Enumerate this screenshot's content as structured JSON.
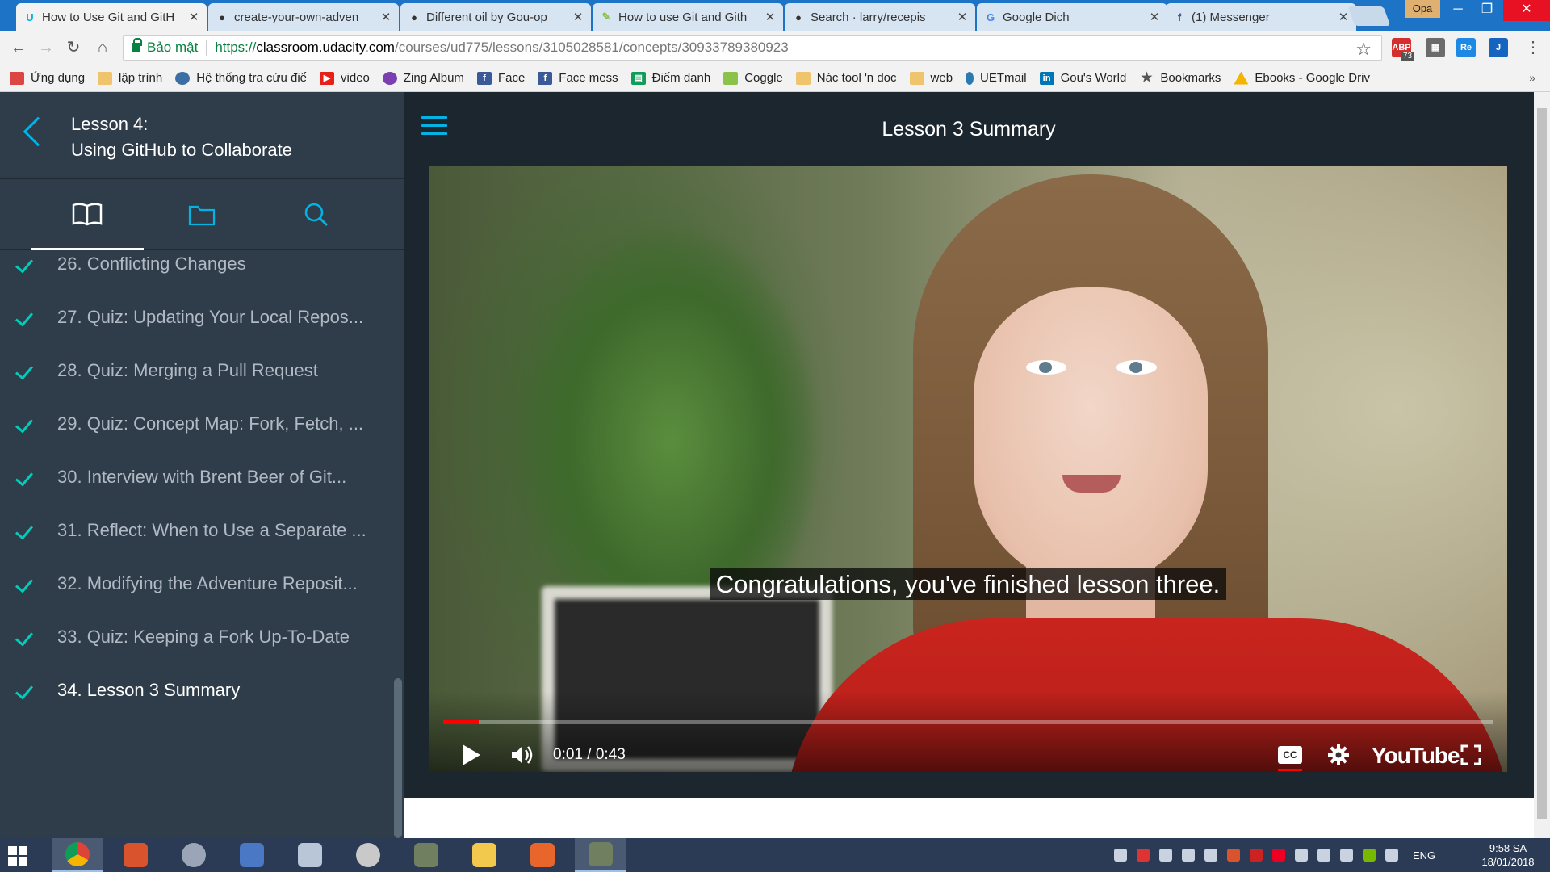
{
  "browser": {
    "tabs": [
      {
        "title": "How to Use Git and GitH",
        "favicon": "udacity-icon",
        "active": true
      },
      {
        "title": "create-your-own-adven",
        "favicon": "github-icon",
        "active": false
      },
      {
        "title": "Different oil by Gou-op",
        "favicon": "github-icon",
        "active": false
      },
      {
        "title": "How to use Git and Gith",
        "favicon": "coggle-icon",
        "active": false
      },
      {
        "title": "Search · larry/recepis",
        "favicon": "github-icon",
        "active": false
      },
      {
        "title": "Google Dich",
        "favicon": "google-translate-icon",
        "active": false
      },
      {
        "title": "(1) Messenger",
        "favicon": "facebook-icon",
        "active": false
      }
    ],
    "profile_label": "Opa",
    "security_label": "Bảo mật",
    "url": {
      "scheme": "https://",
      "host": "classroom.udacity.com",
      "path": "/courses/ud775/lessons/3105028581/concepts/30933789380923"
    },
    "extension_badge": "73",
    "bookmarks": [
      {
        "label": "Ứng dụng",
        "icon": "apps-grid-icon",
        "color": "#d44"
      },
      {
        "label": "lập trình",
        "icon": "folder-icon",
        "color": "#f0c36d"
      },
      {
        "label": "Hệ thống tra cứu điể",
        "icon": "globe-icon",
        "color": "#3a6ea5"
      },
      {
        "label": "video",
        "icon": "youtube-icon",
        "color": "#e62117"
      },
      {
        "label": "Zing Album",
        "icon": "zing-icon",
        "color": "#7b3fb0"
      },
      {
        "label": "Face",
        "icon": "facebook-icon",
        "color": "#3b5998"
      },
      {
        "label": "Face mess",
        "icon": "facebook-icon",
        "color": "#3b5998"
      },
      {
        "label": "Điểm danh",
        "icon": "sheets-icon",
        "color": "#0f9d58"
      },
      {
        "label": "Coggle",
        "icon": "coggle-icon",
        "color": "#8bc34a"
      },
      {
        "label": "Nác tool 'n doc",
        "icon": "folder-icon",
        "color": "#f0c36d"
      },
      {
        "label": "web",
        "icon": "folder-icon",
        "color": "#f0c36d"
      },
      {
        "label": "UETmail",
        "icon": "uetmail-icon",
        "color": "#2a7ab0"
      },
      {
        "label": "Gou's World",
        "icon": "linkedin-icon",
        "color": "#0077b5"
      },
      {
        "label": "Bookmarks",
        "icon": "star-icon",
        "color": "#555555"
      },
      {
        "label": "Ebooks - Google Driv",
        "icon": "google-drive-icon",
        "color": "#f4b400"
      }
    ],
    "bookmarks_more": "»"
  },
  "sidebar": {
    "lesson_number": "Lesson 4:",
    "lesson_name": "Using GitHub to Collaborate",
    "tabs": [
      {
        "name": "book-icon",
        "active": true
      },
      {
        "name": "folder-icon",
        "active": false
      },
      {
        "name": "search-icon",
        "active": false
      }
    ],
    "items": [
      {
        "label": "26. Conflicting Changes",
        "completed": true,
        "current": false
      },
      {
        "label": "27. Quiz: Updating Your Local Repos...",
        "completed": true,
        "current": false
      },
      {
        "label": "28. Quiz: Merging a Pull Request",
        "completed": true,
        "current": false
      },
      {
        "label": "29. Quiz: Concept Map: Fork, Fetch, ...",
        "completed": true,
        "current": false
      },
      {
        "label": "30. Interview with Brent Beer of Git...",
        "completed": true,
        "current": false
      },
      {
        "label": "31. Reflect: When to Use a Separate ...",
        "completed": true,
        "current": false
      },
      {
        "label": "32. Modifying the Adventure Reposit...",
        "completed": true,
        "current": false
      },
      {
        "label": "33. Quiz: Keeping a Fork Up-To-Date",
        "completed": true,
        "current": false
      },
      {
        "label": "34. Lesson 3 Summary",
        "completed": true,
        "current": true
      }
    ]
  },
  "content": {
    "title": "Lesson 3 Summary",
    "video": {
      "subtitle": "Congratulations, you've finished lesson three.",
      "current_time": "0:01",
      "duration": "0:43",
      "time_separator": " / ",
      "progress_fraction": 0.034,
      "cc_label": "CC",
      "logo": "YouTube"
    }
  },
  "taskbar": {
    "apps": [
      {
        "name": "chrome-taskbar-icon",
        "color": "#db4437",
        "active": true
      },
      {
        "name": "security-shield-taskbar-icon",
        "color": "#d9532c",
        "active": false
      },
      {
        "name": "molecule-app-taskbar-icon",
        "color": "#9aa6b8",
        "active": false
      },
      {
        "name": "computer-app-taskbar-icon",
        "color": "#4a78c4",
        "active": false
      },
      {
        "name": "monitor-app-taskbar-icon",
        "color": "#b8c6d8",
        "active": false
      },
      {
        "name": "disc-app-taskbar-icon",
        "color": "#c9c9c9",
        "active": false
      },
      {
        "name": "game-app-taskbar-icon",
        "color": "#6f7f60",
        "active": false
      },
      {
        "name": "file-explorer-taskbar-icon",
        "color": "#f2c94c",
        "active": false
      },
      {
        "name": "office-taskbar-icon",
        "color": "#e8662c",
        "active": false
      },
      {
        "name": "game-app-2-taskbar-icon",
        "color": "#6f7f60",
        "active": true
      }
    ],
    "language": "ENG",
    "time": "9:58 SA",
    "date": "18/01/2018"
  }
}
